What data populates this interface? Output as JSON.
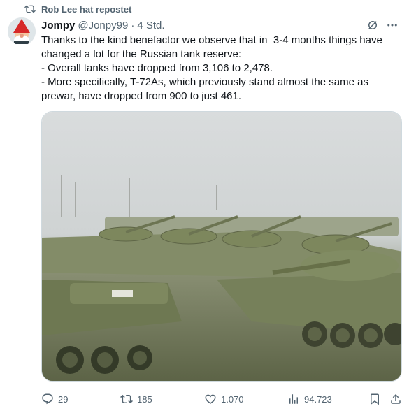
{
  "repost": {
    "text": "Rob Lee hat repostet",
    "icon": "repost-icon"
  },
  "author": {
    "name": "Jompy",
    "handle": "@Jonpy99",
    "separator": "·",
    "time": "4 Std.",
    "avatar": "gnome-avatar"
  },
  "tweet": {
    "lines": [
      "Thanks to the kind benefactor we observe that in  3-4 months things have changed a lot for the Russian tank reserve:",
      "- Overall tanks have dropped from 3,106 to 2,478.",
      "- More specifically, T-72As, which previously stand almost the same as prewar, have dropped from 900 to just 461."
    ]
  },
  "media": {
    "description_icon": "image",
    "subject": "rows of tanks in fog"
  },
  "actions": {
    "replies": "29",
    "reposts": "185",
    "likes": "1.070",
    "views": "94.723"
  },
  "colors": {
    "text": "#0f1419",
    "secondary": "#536471",
    "border": "#cfd9de"
  }
}
